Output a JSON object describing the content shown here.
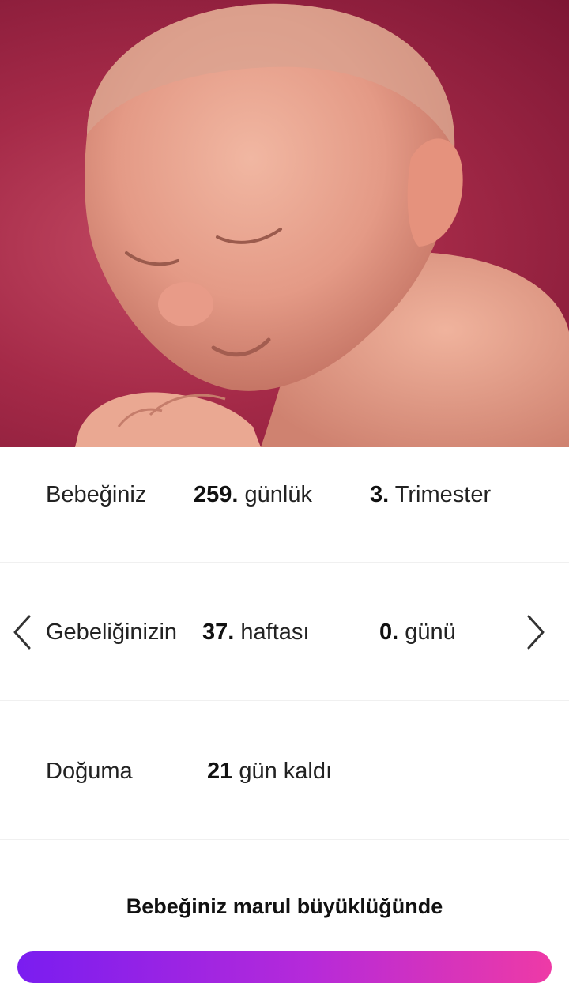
{
  "hero": {
    "image_label": "baby-37-weeks"
  },
  "summary": {
    "age_label": "Bebeğiniz",
    "age_days_value": "259.",
    "age_days_unit": "günlük",
    "trimester_value": "3.",
    "trimester_unit": "Trimester"
  },
  "week": {
    "label": "Gebeliğinizin",
    "week_value": "37.",
    "week_unit": "haftası",
    "day_value": "0.",
    "day_unit": "günü",
    "prev_icon": "chevron-left-icon",
    "next_icon": "chevron-right-icon"
  },
  "due": {
    "label": "Doğuma",
    "days_value": "21",
    "days_unit": "gün kaldı"
  },
  "size": {
    "text": "Bebeğiniz marul büyüklüğünde"
  },
  "colors": {
    "cta_start": "#7a1df0",
    "cta_end": "#ee3aa6",
    "hero_bg": "#a52a48"
  }
}
